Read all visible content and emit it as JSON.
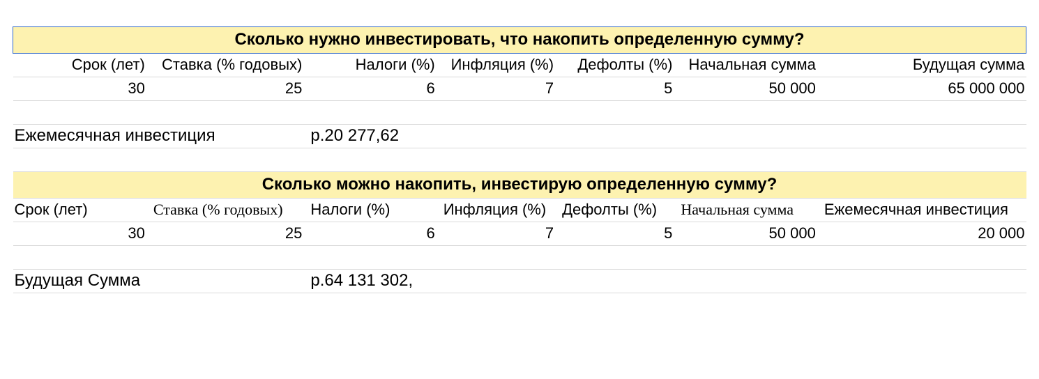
{
  "block1": {
    "title": "Сколько нужно инвестировать, что накопить определенную сумму?",
    "headers": {
      "term": "Срок (лет)",
      "rate": "Ставка (% годовых)",
      "tax": "Налоги (%)",
      "inflation": "Инфляция (%)",
      "defaults": "Дефолты (%)",
      "initial": "Начальная сумма",
      "future": "Будущая сумма"
    },
    "values": {
      "term": "30",
      "rate": "25",
      "tax": "6",
      "inflation": "7",
      "defaults": "5",
      "initial": "50 000",
      "future": "65 000 000"
    },
    "result_label": "Ежемесячная инвестиция",
    "result_value": "р.20 277,62"
  },
  "block2": {
    "title": "Сколько можно накопить, инвестирую определенную сумму?",
    "headers": {
      "term": "Срок (лет)",
      "rate": "Ставка (% годовых)",
      "tax": "Налоги (%)",
      "inflation": "Инфляция (%)",
      "defaults": "Дефолты (%)",
      "initial": "Начальная сумма",
      "monthly": "Ежемесячная инвестиция"
    },
    "values": {
      "term": "30",
      "rate": "25",
      "tax": "6",
      "inflation": "7",
      "defaults": "5",
      "initial": "50 000",
      "monthly": "20 000"
    },
    "result_label": "Будущая Сумма",
    "result_value": "р.64 131 302,"
  }
}
